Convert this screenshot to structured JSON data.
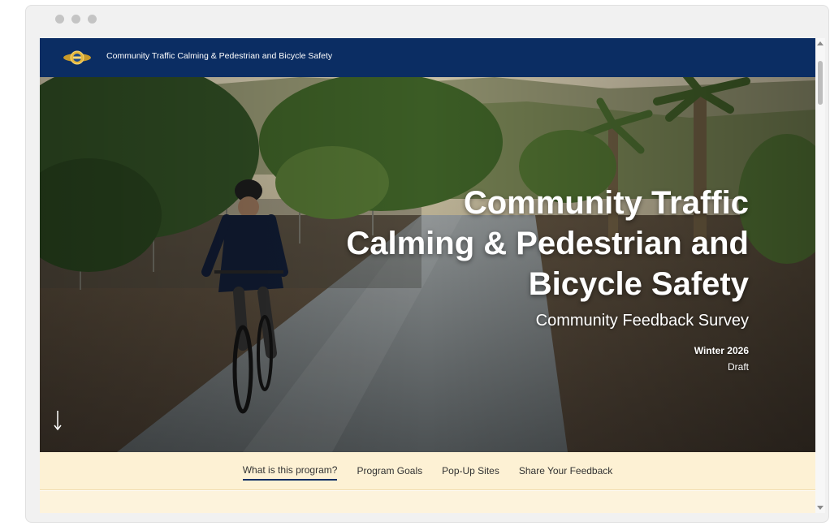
{
  "window": {
    "controls": [
      "dot",
      "dot",
      "dot"
    ]
  },
  "header": {
    "title": "Community Traffic Calming & Pedestrian and Bicycle Safety",
    "logo_icon": "agency-logo-icon"
  },
  "hero": {
    "title": "Community Traffic Calming & Pedestrian and Bicycle Safety",
    "subtitle": "Community Feedback Survey",
    "season": "Winter 2026",
    "status": "Draft",
    "scroll_icon": "arrow-down-icon"
  },
  "nav": {
    "items": [
      {
        "label": "What is this program?",
        "active": true
      },
      {
        "label": "Program Goals",
        "active": false
      },
      {
        "label": "Pop-Up Sites",
        "active": false
      },
      {
        "label": "Share Your Feedback",
        "active": false
      }
    ]
  },
  "colors": {
    "header_bg": "#0b2d63",
    "nav_bg": "#fdf1d4",
    "active_underline": "#0b2d63"
  }
}
